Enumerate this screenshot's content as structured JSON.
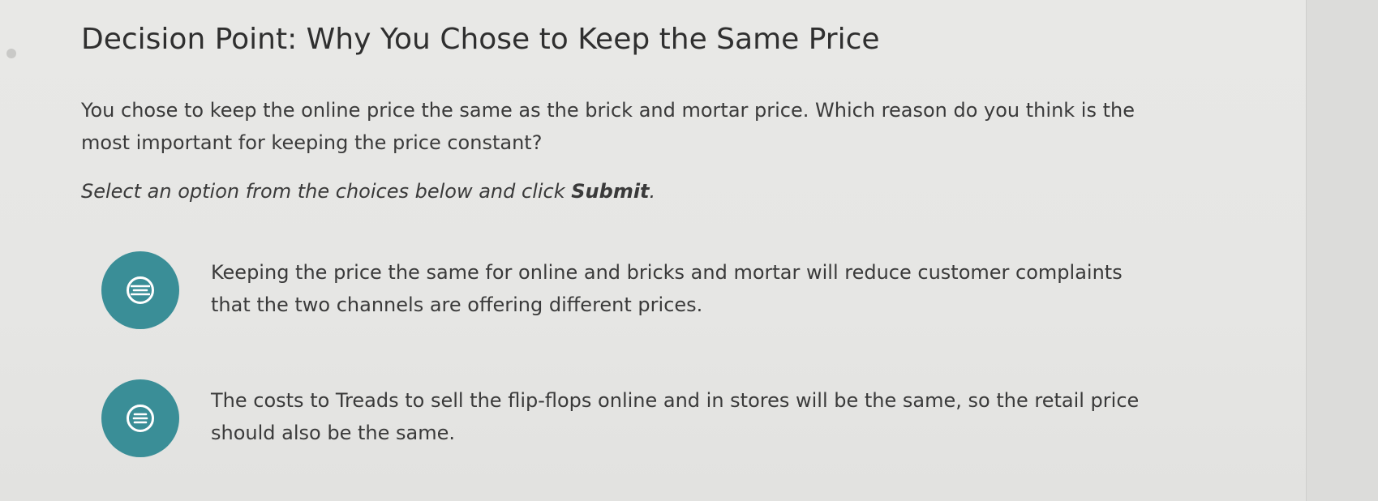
{
  "decision": {
    "title": "Decision Point: Why You Chose to Keep the Same Price",
    "prompt": "You chose to keep the online price the same as the brick and mortar price. Which reason do you think is the most important for keeping the price constant?",
    "instruction_prefix": "Select an option from the choices below and click ",
    "instruction_action": "Submit",
    "instruction_suffix": "."
  },
  "options": [
    {
      "text": "Keeping the price the same for online and bricks and mortar will reduce customer complaints that the two channels are offering different prices.",
      "icon": "radio-option-icon"
    },
    {
      "text": "The costs to Treads to sell the flip-flops online and in stores will be the same, so the retail price should also be the same.",
      "icon": "radio-option-icon"
    }
  ],
  "colors": {
    "accent": "#3a8e97",
    "background": "#e6e6e4",
    "text": "#3a3a3a"
  }
}
